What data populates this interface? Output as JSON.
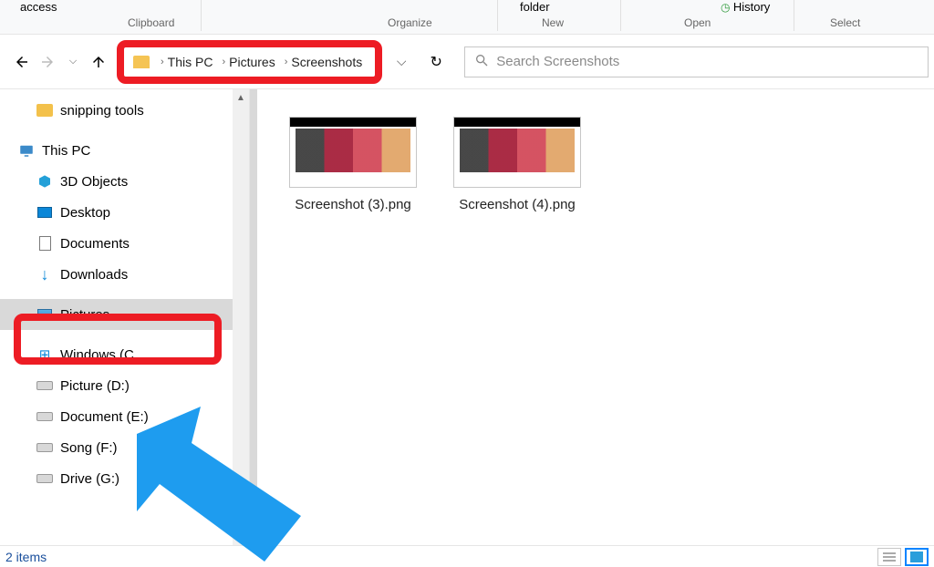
{
  "ribbon": {
    "access": "access",
    "clipboard_label": "Clipboard",
    "organize_label": "Organize",
    "folder": "folder",
    "new_label": "New",
    "open_label": "Open",
    "history_label": "History",
    "select_label": "Select"
  },
  "breadcrumb": {
    "segments": [
      "This PC",
      "Pictures",
      "Screenshots"
    ]
  },
  "search": {
    "placeholder": "Search Screenshots"
  },
  "tree": {
    "snipping": "snipping tools",
    "this_pc": "This PC",
    "items": [
      "3D Objects",
      "Desktop",
      "Documents",
      "Downloads",
      "",
      "Pictures",
      "",
      "Windows  (C",
      "Picture (D:)",
      "Document (E:)",
      "Song  (F:)",
      "Drive (G:)"
    ]
  },
  "files": [
    {
      "name": "Screenshot (3).png"
    },
    {
      "name": "Screenshot (4).png"
    }
  ],
  "status": {
    "count": "2 items"
  }
}
